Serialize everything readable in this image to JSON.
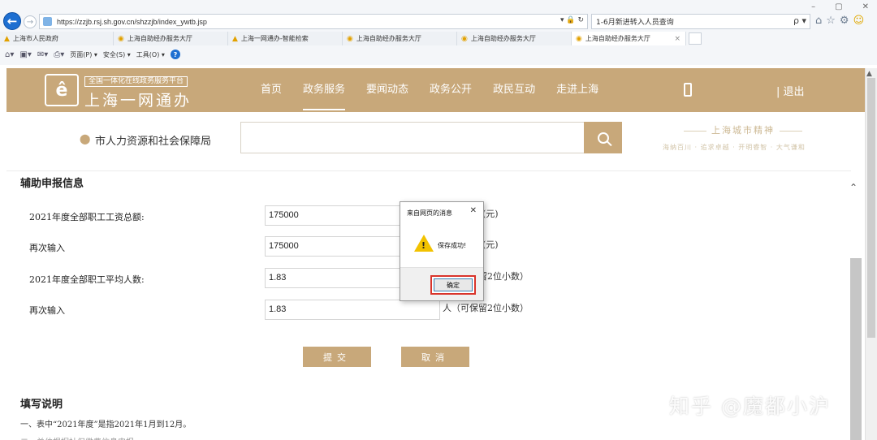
{
  "browser": {
    "url": "https://zzjb.rsj.sh.gov.cn/shzzjb/index_ywtb.jsp",
    "url_tools": "▾ 🔒 ↻",
    "search_text": "1-6月新进转入人员查询",
    "search_go": "ρ ▾",
    "window_controls": [
      "–",
      "▢",
      "✕"
    ],
    "tabs": [
      {
        "label": "上海市人民政府",
        "icon": "shield-icon"
      },
      {
        "label": "上海自助经办服务大厅",
        "icon": "page-icon"
      },
      {
        "label": "上海一网通办-智能检索",
        "icon": "shield-icon"
      },
      {
        "label": "上海自助经办服务大厅",
        "icon": "page-icon"
      },
      {
        "label": "上海自助经办服务大厅",
        "icon": "page-icon"
      },
      {
        "label": "上海自助经办服务大厅",
        "icon": "page-icon"
      }
    ],
    "tab_close": "×",
    "command_bar": {
      "page": "页面(P) ▾",
      "safety": "安全(S) ▾",
      "tools": "工具(O) ▾",
      "help": "?"
    }
  },
  "header": {
    "logo_mark": "ê",
    "logo_subtitle": "全国一体化在线政务服务平台",
    "logo_title": "上海一网通办",
    "nav": [
      "首页",
      "政务服务",
      "要闻动态",
      "政务公开",
      "政民互动",
      "走进上海"
    ],
    "active_nav": "政务服务",
    "logout": "| 退出"
  },
  "search_area": {
    "department": "市人力资源和社会保障局",
    "spirit_title": "上海城市精神",
    "spirit_sub": "海纳百川 · 追求卓越 · 开明睿智 · 大气谦和"
  },
  "form": {
    "section_title": "辅助申报信息",
    "rows": [
      {
        "label": "2021年度全部职工工资总额:",
        "value": "175000",
        "unit": "(元)"
      },
      {
        "label": "再次输入",
        "value": "175000",
        "unit": "(元)"
      },
      {
        "label": "2021年度全部职工平均人数:",
        "value": "1.83",
        "unit": "人（可保留2位小数）"
      },
      {
        "label": "再次输入",
        "value": "1.83",
        "unit": "人（可保留2位小数）"
      }
    ],
    "submit_label": "提交",
    "cancel_label": "取消"
  },
  "notes": {
    "title": "填写说明",
    "item_1": "一、表中“2021年度”是指2021年1月到12月。",
    "item_2": "二、单位根据社保缴费信息申报..."
  },
  "dialog": {
    "title": "来自网页的消息",
    "close": "✕",
    "message": "保存成功!",
    "warn_mark": "!",
    "ok_label": "确定"
  },
  "watermark": "知乎 @魔都小沪",
  "colors": {
    "brand_gold": "#c8a87a",
    "ie_blue": "#1e6fd1",
    "dialog_highlight": "#d9342b"
  }
}
